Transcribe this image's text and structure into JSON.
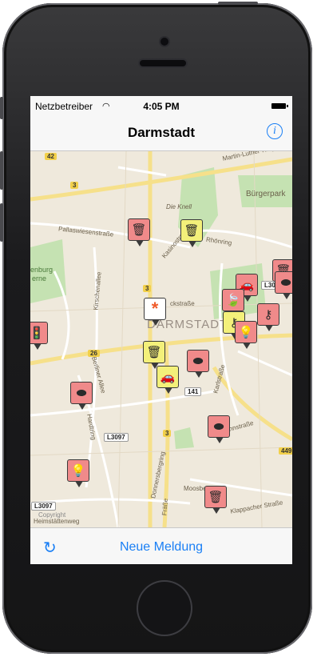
{
  "status": {
    "carrier": "Netzbetreiber",
    "time": "4:05 PM"
  },
  "nav": {
    "title": "Darmstadt"
  },
  "map": {
    "city_label": "DARMSTADT",
    "labels": [
      "Martin-Luther-King",
      "Bürgerpark",
      "Die Knell",
      "Pallaswiesenstraße",
      "Kasinostraße",
      "Rhönring",
      "Kirschenallee",
      "Berliner Allee",
      "Hardtring",
      "Donnersbergring",
      "Moosberg",
      "Jahnstraße",
      "Karlstraße",
      "Klappacher Straße",
      "Heimstättenweg",
      "enburg",
      "erne",
      "Copyright",
      "Fräße",
      "ckstraße"
    ],
    "shields": [
      "42",
      "3",
      "3",
      "26",
      "141",
      "3",
      "449",
      "L3097",
      "L3097",
      "L309"
    ]
  },
  "pins": [
    {
      "type": "trash",
      "color": "red"
    },
    {
      "type": "trash",
      "color": "yellow"
    },
    {
      "type": "trash",
      "color": "red"
    },
    {
      "type": "asterisk",
      "color": "white",
      "glyph": "*"
    },
    {
      "type": "streetlight",
      "color": "red"
    },
    {
      "type": "car",
      "color": "red"
    },
    {
      "type": "leaf",
      "color": "red"
    },
    {
      "type": "keys",
      "color": "yellow"
    },
    {
      "type": "bulb",
      "color": "red"
    },
    {
      "type": "keys",
      "color": "red"
    },
    {
      "type": "trash",
      "color": "yellow"
    },
    {
      "type": "car",
      "color": "yellow"
    },
    {
      "type": "pothole",
      "color": "red"
    },
    {
      "type": "pothole",
      "color": "red"
    },
    {
      "type": "pothole",
      "color": "red"
    },
    {
      "type": "bulb",
      "color": "red"
    },
    {
      "type": "trash",
      "color": "red"
    },
    {
      "type": "traffic-light",
      "color": "red"
    }
  ],
  "toolbar": {
    "new_report_label": "Neue Meldung"
  }
}
